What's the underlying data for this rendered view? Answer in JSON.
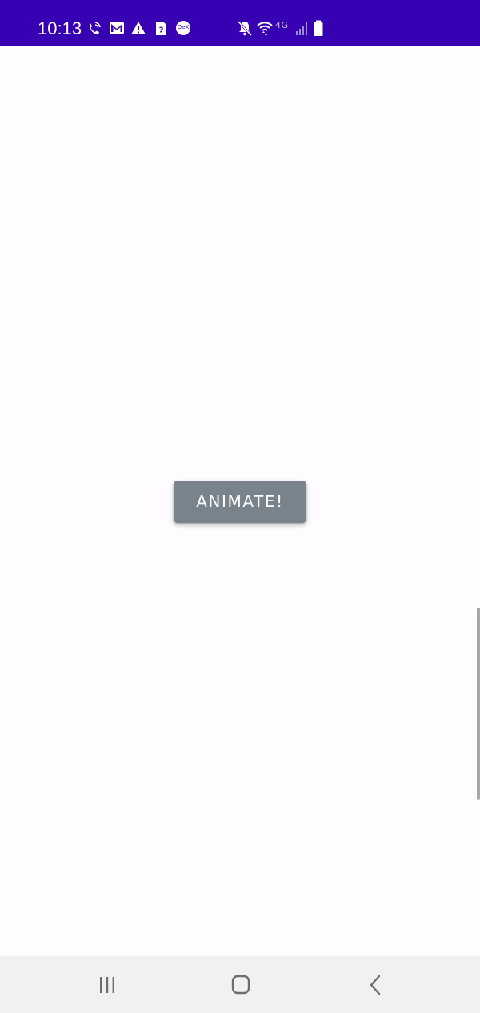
{
  "status_bar": {
    "time": "10:13",
    "background_color": "#3700b3",
    "left_icons": [
      "wifi-calling-icon",
      "gmail-icon",
      "warning-icon",
      "sim-unknown-icon",
      "dex-icon"
    ],
    "right_icons": [
      "mute-icon",
      "wifi-icon",
      "network-4g-icon",
      "signal-icon",
      "battery-icon"
    ],
    "dex_label": "DeX",
    "network_label": "4G"
  },
  "main": {
    "button_label": "ANIMATE!",
    "button_color": "#78838b"
  },
  "nav_bar": {
    "items": [
      "recent-apps",
      "home",
      "back"
    ]
  }
}
